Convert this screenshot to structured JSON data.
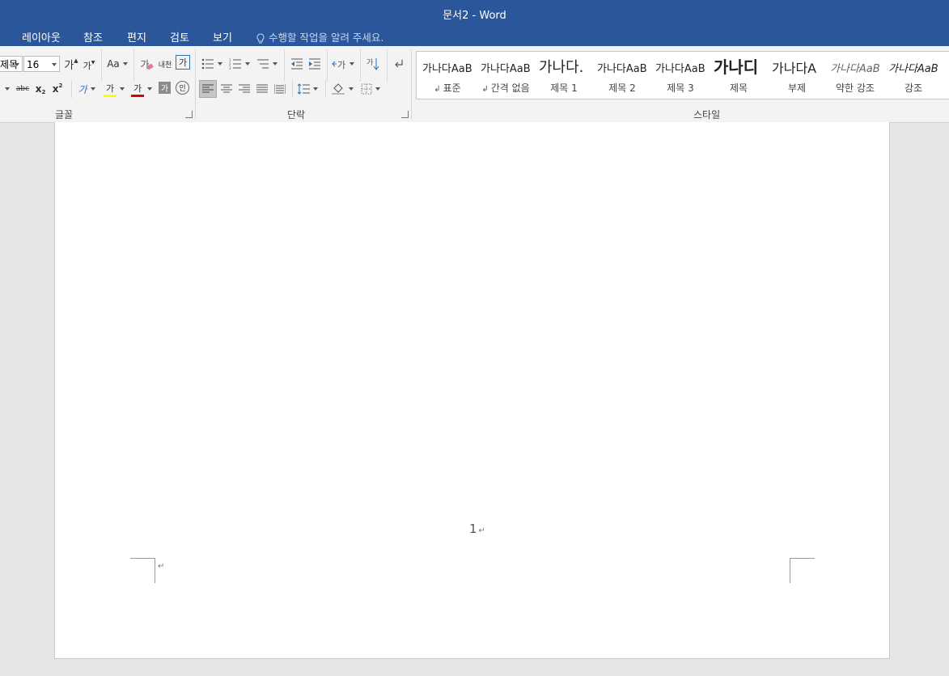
{
  "window": {
    "title": "문서2 - Word"
  },
  "menu": {
    "tabs": [
      "레이아웃",
      "참조",
      "편지",
      "검토",
      "보기"
    ],
    "tell_me": "수행할 작업을 알려 주세요."
  },
  "ribbon": {
    "font": {
      "name_value": "제목",
      "size_value": "16",
      "grow_label": "가",
      "shrink_label": "가",
      "case_label": "Aa",
      "clear_label": "가",
      "phonetic_label": "내천",
      "enclose_label": "가",
      "strike_label": "abc",
      "sub_label": "x",
      "sup_label": "x",
      "effect_label": "가",
      "highlight_label": "가",
      "color_label": "가",
      "shade_label": "가",
      "circle_label": "인",
      "group_label": "글꼴"
    },
    "paragraph": {
      "group_label": "단락",
      "sort_label": "가"
    },
    "styles": {
      "group_label": "스타일",
      "items": [
        {
          "preview": "가나다AaB",
          "label": "표준",
          "mark": "↲"
        },
        {
          "preview": "가나다AaB",
          "label": "간격 없음",
          "mark": "↲"
        },
        {
          "preview": "가나다.",
          "label": "제목 1"
        },
        {
          "preview": "가나다AaB",
          "label": "제목 2"
        },
        {
          "preview": "가나다AaB",
          "label": "제목 3"
        },
        {
          "preview": "가나디",
          "label": "제목"
        },
        {
          "preview": "가나다A",
          "label": "부제"
        },
        {
          "preview": "가나다AaB",
          "label": "약한 강조"
        },
        {
          "preview": "가나다AaB",
          "label": "강조"
        }
      ]
    }
  },
  "document": {
    "page_number": "1",
    "para_mark": "↵"
  },
  "colors": {
    "brand": "#2b579a",
    "highlight": "#ffff00",
    "font_color": "#e00000"
  }
}
